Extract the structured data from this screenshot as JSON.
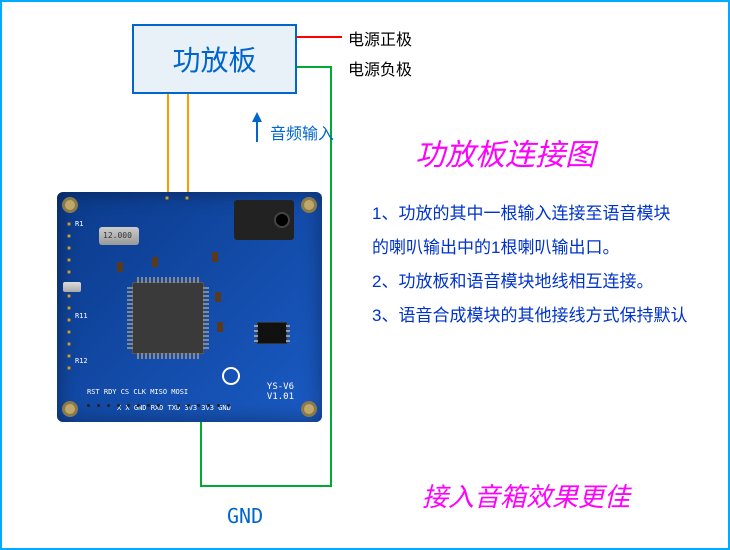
{
  "amp_box_label": "功放板",
  "power_pos_label": "电源正极",
  "power_neg_label": "电源负极",
  "audio_in_label": "音频输入",
  "gnd_label": "GND",
  "title": "功放板连接图",
  "notes": {
    "line1": "1、功放的其中一根输入连接至语音模块",
    "line2": "的喇叭输出中的1根喇叭输出口。",
    "line3": "2、功放板和语音模块地线相互连接。",
    "line4": "3、语音合成模块的其他接线方式保持默认"
  },
  "footer": "接入音箱效果更佳",
  "pcb_silk": {
    "crystal": "12.000",
    "board_id": "YS-V6",
    "board_ver": "V1.01",
    "bottom_pins": "X X GND RXD TXD 3V3  3V3 GND",
    "bottom_left_pins": "RST RDY CS CLK MISO MOSI"
  },
  "colors": {
    "wire_red": "#ff0000",
    "wire_green": "#00aa33",
    "wire_orange": "#ff9900",
    "border": "#00aaff"
  }
}
